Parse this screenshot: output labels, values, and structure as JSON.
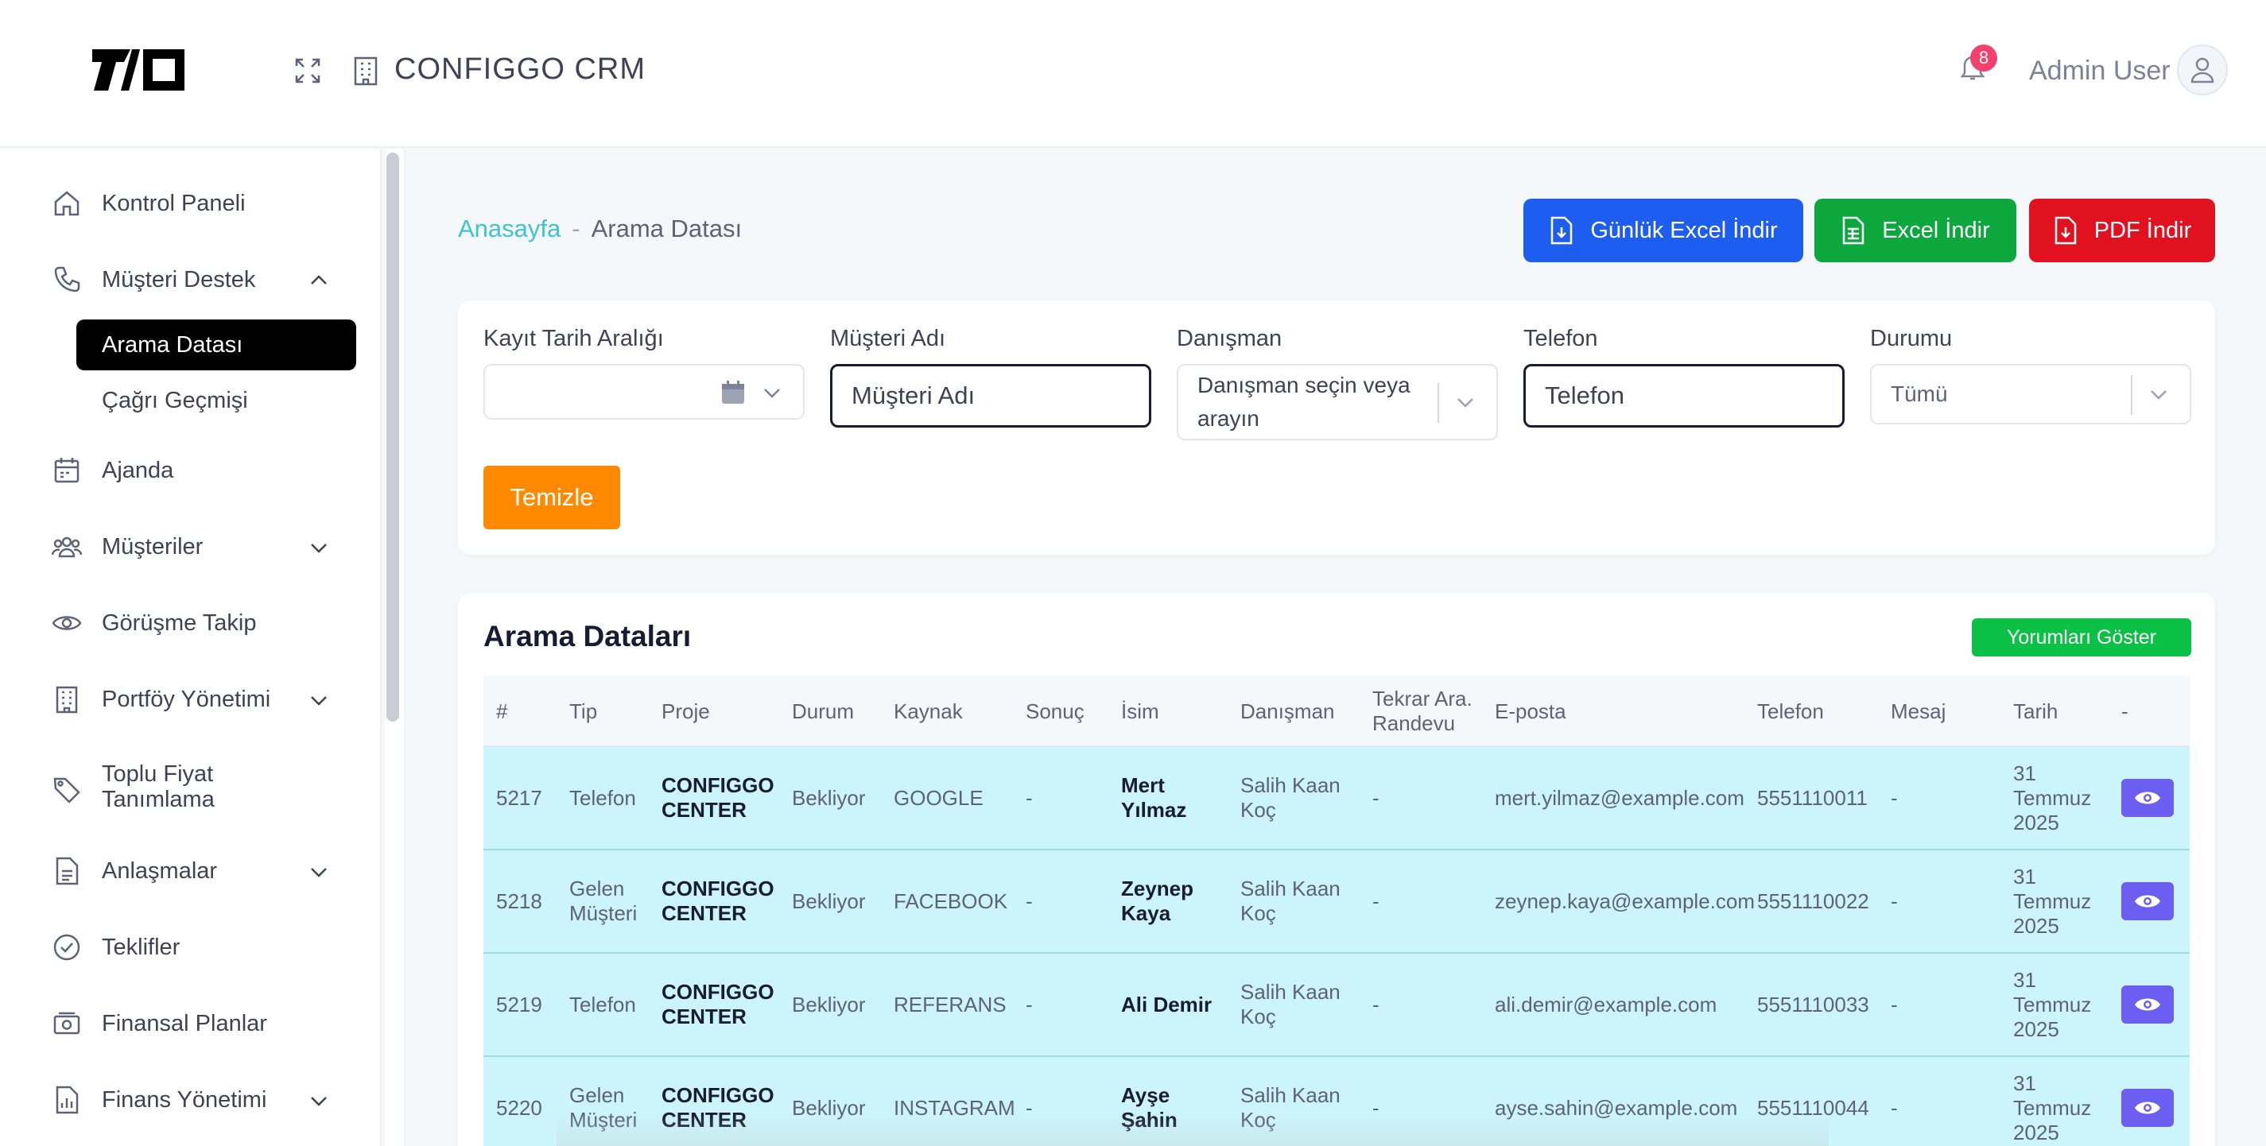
{
  "header": {
    "app_title": "CONFIGGO  CRM",
    "notification_count": "8",
    "user_name": "Admin User"
  },
  "sidebar": {
    "items": [
      {
        "label": "Kontrol Paneli",
        "icon": "home-icon"
      },
      {
        "label": "Müşteri Destek",
        "icon": "phone-icon",
        "expanded": true
      },
      {
        "label": "Ajanda",
        "icon": "calendar-icon"
      },
      {
        "label": "Müşteriler",
        "icon": "users-icon"
      },
      {
        "label": "Görüşme Takip",
        "icon": "eye-icon"
      },
      {
        "label": "Portföy Yönetimi",
        "icon": "building-icon"
      },
      {
        "label": "Toplu Fiyat",
        "label2": "Tanımlama",
        "icon": "tag-icon"
      },
      {
        "label": "Anlaşmalar",
        "icon": "document-icon"
      },
      {
        "label": "Teklifler",
        "icon": "check-circle-icon"
      },
      {
        "label": "Finansal Planlar",
        "icon": "money-icon"
      },
      {
        "label": "Finans Yönetimi",
        "icon": "chart-icon"
      }
    ],
    "sub_items": [
      {
        "label": "Arama Datası",
        "active": true
      },
      {
        "label": "Çağrı Geçmişi",
        "active": false
      }
    ]
  },
  "breadcrumb": {
    "home": "Anasayfa",
    "separator": "-",
    "current": "Arama Datası"
  },
  "actions": {
    "daily_excel": "Günlük Excel İndir",
    "excel": "Excel İndir",
    "pdf": "PDF İndir"
  },
  "filters": {
    "date_label": "Kayıt Tarih Aralığı",
    "customer_label": "Müşteri Adı",
    "customer_placeholder": "Müşteri Adı",
    "consultant_label": "Danışman",
    "consultant_placeholder_1": "Danışman seçin veya",
    "consultant_placeholder_2": "arayın",
    "phone_label": "Telefon",
    "phone_placeholder": "Telefon",
    "status_label": "Durumu",
    "status_value": "Tümü",
    "clear_button": "Temizle"
  },
  "table": {
    "title": "Arama Dataları",
    "comments_button": "Yorumları Göster",
    "headers": [
      "#",
      "Tip",
      "Proje",
      "Durum",
      "Kaynak",
      "Sonuç",
      "İsim",
      "Danışman",
      "Tekrar Ara.",
      "Randevu",
      "E-posta",
      "Telefon",
      "Mesaj",
      "Tarih",
      "-"
    ],
    "rows": [
      {
        "id": "5217",
        "tip1": "Telefon",
        "tip2": "",
        "proje1": "CONFIGGO",
        "proje2": "CENTER",
        "durum": "Bekliyor",
        "kaynak": "GOOGLE",
        "sonuc": "-",
        "isim1": "Mert",
        "isim2": "Yılmaz",
        "danisman1": "Salih Kaan",
        "danisman2": "Koç",
        "tekrar": "-",
        "eposta": "mert.yilmaz@example.com",
        "telefon": "5551110011",
        "mesaj": "-",
        "tarih1": "31",
        "tarih2": "Temmuz",
        "tarih3": "2025"
      },
      {
        "id": "5218",
        "tip1": "Gelen",
        "tip2": "Müşteri",
        "proje1": "CONFIGGO",
        "proje2": "CENTER",
        "durum": "Bekliyor",
        "kaynak": "FACEBOOK",
        "sonuc": "-",
        "isim1": "Zeynep",
        "isim2": "Kaya",
        "danisman1": "Salih Kaan",
        "danisman2": "Koç",
        "tekrar": "-",
        "eposta": "zeynep.kaya@example.com",
        "telefon": "5551110022",
        "mesaj": "-",
        "tarih1": "31",
        "tarih2": "Temmuz",
        "tarih3": "2025"
      },
      {
        "id": "5219",
        "tip1": "Telefon",
        "tip2": "",
        "proje1": "CONFIGGO",
        "proje2": "CENTER",
        "durum": "Bekliyor",
        "kaynak": "REFERANS",
        "sonuc": "-",
        "isim1": "Ali Demir",
        "isim2": "",
        "danisman1": "Salih Kaan",
        "danisman2": "Koç",
        "tekrar": "-",
        "eposta": "ali.demir@example.com",
        "telefon": "5551110033",
        "mesaj": "-",
        "tarih1": "31",
        "tarih2": "Temmuz",
        "tarih3": "2025"
      },
      {
        "id": "5220",
        "tip1": "Gelen",
        "tip2": "Müşteri",
        "proje1": "CONFIGGO",
        "proje2": "CENTER",
        "durum": "Bekliyor",
        "kaynak": "INSTAGRAM",
        "sonuc": "-",
        "isim1": "Ayşe",
        "isim2": "Şahin",
        "danisman1": "Salih Kaan",
        "danisman2": "Koç",
        "tekrar": "-",
        "eposta": "ayse.sahin@example.com",
        "telefon": "5551110044",
        "mesaj": "-",
        "tarih1": "31",
        "tarih2": "Temmuz",
        "tarih3": "2025"
      }
    ]
  },
  "colors": {
    "accent_blue": "#1d5ef0",
    "accent_green": "#0ca83d",
    "accent_red": "#e1111f",
    "clear_orange": "#ff8a00",
    "row_highlight": "#cbf5fa",
    "view_button": "#6c5ef0",
    "breadcrumb_link": "#3ec3d2"
  }
}
